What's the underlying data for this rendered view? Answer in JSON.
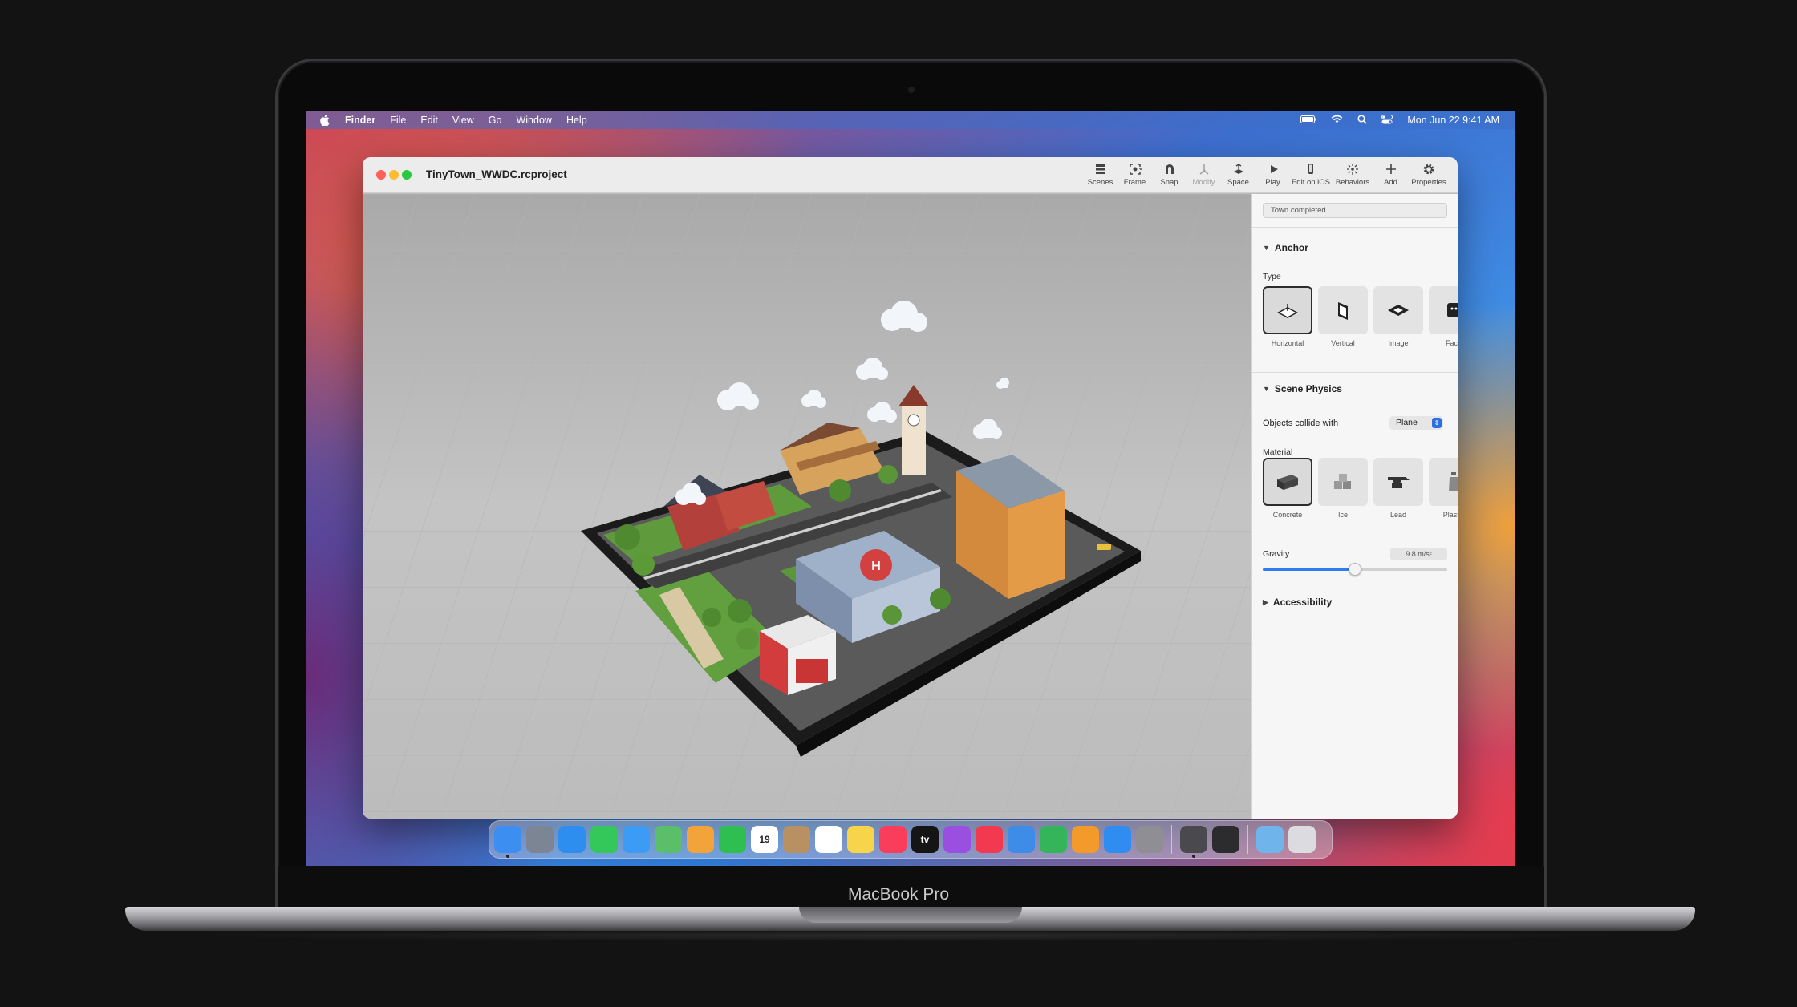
{
  "device": {
    "brand": "MacBook Pro"
  },
  "menubar": {
    "app_name": "Finder",
    "items": [
      "File",
      "Edit",
      "View",
      "Go",
      "Window",
      "Help"
    ],
    "date_time": "Mon Jun 22  9:41 AM",
    "icons": [
      "battery-icon",
      "wifi-icon",
      "search-icon",
      "control-center-icon"
    ]
  },
  "window": {
    "title": "TinyTown_WWDC.rcproject",
    "toolbar": [
      {
        "label": "Scenes",
        "icon": "scenes-icon"
      },
      {
        "label": "Frame",
        "icon": "frame-icon"
      },
      {
        "label": "Snap",
        "icon": "magnet-icon"
      },
      {
        "label": "Modify",
        "icon": "modify-icon"
      },
      {
        "label": "Space",
        "icon": "space-icon"
      },
      {
        "label": "Play",
        "icon": "play-icon"
      },
      {
        "label": "Edit on iOS",
        "icon": "iphone-icon"
      },
      {
        "label": "Behaviors",
        "icon": "behaviors-icon"
      },
      {
        "label": "Add",
        "icon": "plus-icon"
      },
      {
        "label": "Properties",
        "icon": "gear-icon"
      }
    ]
  },
  "inspector": {
    "name_value": "Town completed",
    "anchor": {
      "title": "Anchor",
      "type_label": "Type",
      "types": [
        "Horizontal",
        "Vertical",
        "Image",
        "Face"
      ],
      "selected": "Horizontal"
    },
    "physics": {
      "title": "Scene Physics",
      "collide_label": "Objects collide with",
      "collide_value": "Plane",
      "material_label": "Material",
      "materials": [
        "Concrete",
        "Ice",
        "Lead",
        "Plastic"
      ],
      "selected_material": "Concrete",
      "gravity_label": "Gravity",
      "gravity_value": "9.8 m/s²",
      "gravity_fraction": 0.5
    },
    "accessibility": {
      "title": "Accessibility"
    }
  },
  "dock": {
    "apps": [
      {
        "name": "Finder",
        "color": "#3c8ff0",
        "running": true
      },
      {
        "name": "Launchpad",
        "color": "#7c8594"
      },
      {
        "name": "Safari",
        "color": "#2e8ef0"
      },
      {
        "name": "Messages",
        "color": "#34c759"
      },
      {
        "name": "Mail",
        "color": "#3c9cf5"
      },
      {
        "name": "Maps",
        "color": "#5bbf6a"
      },
      {
        "name": "Photos",
        "color": "#f2a33a"
      },
      {
        "name": "FaceTime",
        "color": "#2fbf50"
      },
      {
        "name": "Calendar",
        "color": "#ffffff",
        "text": "19"
      },
      {
        "name": "Contacts",
        "color": "#b89062"
      },
      {
        "name": "Reminders",
        "color": "#ffffff"
      },
      {
        "name": "Notes",
        "color": "#f7d44a"
      },
      {
        "name": "Music",
        "color": "#fa3d5a"
      },
      {
        "name": "TV",
        "color": "#151515",
        "text": "tv"
      },
      {
        "name": "Podcasts",
        "color": "#9b4fe0"
      },
      {
        "name": "News",
        "color": "#f2394f"
      },
      {
        "name": "Keynote",
        "color": "#3d8ce8"
      },
      {
        "name": "Numbers",
        "color": "#34b55a"
      },
      {
        "name": "Pages",
        "color": "#f39a2a"
      },
      {
        "name": "App Store",
        "color": "#2f8cf0"
      },
      {
        "name": "System Preferences",
        "color": "#8e8e93"
      }
    ],
    "apps2": [
      {
        "name": "Reality Composer",
        "color": "#4a4a4e",
        "running": true
      },
      {
        "name": "Reality Converter",
        "color": "#2c2c2e"
      }
    ],
    "apps3": [
      {
        "name": "Downloads",
        "color": "#6fb4ea"
      },
      {
        "name": "Trash",
        "color": "#dcdce0"
      }
    ]
  }
}
